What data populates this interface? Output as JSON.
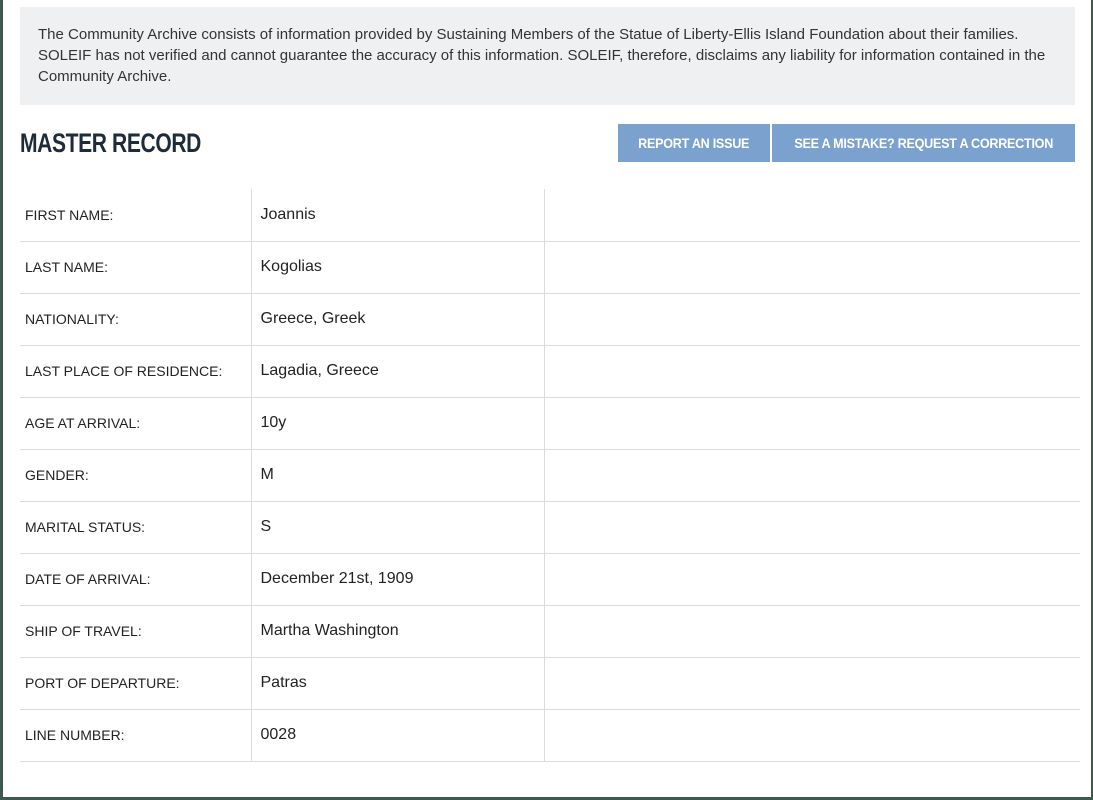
{
  "notice": {
    "text": "The Community Archive consists of information provided by Sustaining Members of the Statue of Liberty-Ellis Island Foundation about their families. SOLEIF has not verified and cannot guarantee the accuracy of this information. SOLEIF, therefore, disclaims any liability for information contained in the Community Archive."
  },
  "header": {
    "title": "MASTER RECORD",
    "report_button": "REPORT AN ISSUE",
    "correction_button": "SEE A MISTAKE? REQUEST A CORRECTION"
  },
  "colors": {
    "button_bg": "#7ba2cf",
    "notice_bg": "#eef0f2",
    "frame": "#3d5a4e"
  },
  "record": {
    "rows": [
      {
        "label": "FIRST NAME:",
        "value": "Joannis"
      },
      {
        "label": "LAST NAME:",
        "value": "Kogolias"
      },
      {
        "label": "NATIONALITY:",
        "value": "Greece, Greek"
      },
      {
        "label": "LAST PLACE OF RESIDENCE:",
        "value": "Lagadia, Greece"
      },
      {
        "label": "AGE AT ARRIVAL:",
        "value": "10y"
      },
      {
        "label": "GENDER:",
        "value": "M"
      },
      {
        "label": "MARITAL STATUS:",
        "value": "S"
      },
      {
        "label": "DATE OF ARRIVAL:",
        "value": "December 21st, 1909"
      },
      {
        "label": "SHIP OF TRAVEL:",
        "value": "Martha Washington"
      },
      {
        "label": "PORT OF DEPARTURE:",
        "value": "Patras"
      },
      {
        "label": "LINE NUMBER:",
        "value": "0028"
      }
    ]
  }
}
